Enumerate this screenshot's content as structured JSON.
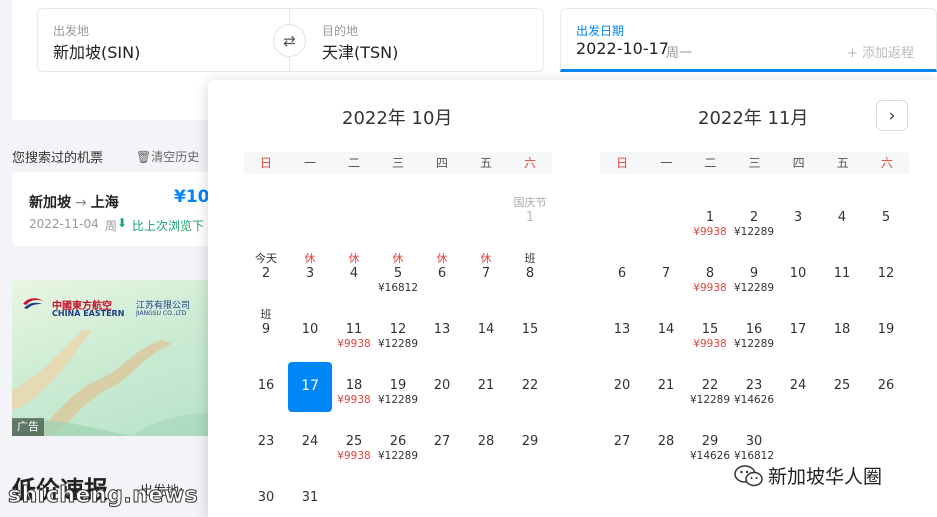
{
  "search": {
    "from_label": "出发地",
    "from_value": "新加坡(SIN)",
    "to_label": "目的地",
    "to_value": "天津(TSN)",
    "date_label": "出发日期",
    "date_value": "2022-10-17",
    "date_weekday": "周一",
    "add_return": "+ 添加返程"
  },
  "history": {
    "title": "您搜索过的机票",
    "clear": "清空历史",
    "card": {
      "from": "新加坡",
      "to": "上海",
      "price": "¥10",
      "date": "2022-11-04",
      "weekday": "周",
      "trend": "比上次浏览下"
    }
  },
  "ad": {
    "brand_cn": "中國東方航空",
    "brand_en": "CHINA EASTERN",
    "branch_cn": "江苏有限公司",
    "branch_en": "JIANGSU CO.,LTD",
    "tag": "广告"
  },
  "deals": {
    "title": "低价速报",
    "from_label": "出发地:"
  },
  "calendar": {
    "weekdays": [
      "日",
      "一",
      "二",
      "三",
      "四",
      "五",
      "六"
    ],
    "october": {
      "title": "2022年 10月",
      "days": [
        {
          "d": "1",
          "top": "国庆节",
          "top_type": "holiday",
          "muted": true
        },
        {
          "d": "2",
          "top": "今天"
        },
        {
          "d": "3",
          "top": "休",
          "top_type": "rest"
        },
        {
          "d": "4",
          "top": "休",
          "top_type": "rest"
        },
        {
          "d": "5",
          "top": "休",
          "top_type": "rest",
          "price": "¥16812"
        },
        {
          "d": "6",
          "top": "休",
          "top_type": "rest"
        },
        {
          "d": "7",
          "top": "休",
          "top_type": "rest"
        },
        {
          "d": "8",
          "top": "班"
        },
        {
          "d": "9",
          "top": "班"
        },
        {
          "d": "10"
        },
        {
          "d": "11",
          "price": "¥9938",
          "low": true
        },
        {
          "d": "12",
          "price": "¥12289"
        },
        {
          "d": "13"
        },
        {
          "d": "14"
        },
        {
          "d": "15"
        },
        {
          "d": "16"
        },
        {
          "d": "17",
          "selected": true
        },
        {
          "d": "18",
          "price": "¥9938",
          "low": true
        },
        {
          "d": "19",
          "price": "¥12289"
        },
        {
          "d": "20"
        },
        {
          "d": "21"
        },
        {
          "d": "22"
        },
        {
          "d": "23"
        },
        {
          "d": "24"
        },
        {
          "d": "25",
          "price": "¥9938",
          "low": true
        },
        {
          "d": "26",
          "price": "¥12289"
        },
        {
          "d": "27"
        },
        {
          "d": "28"
        },
        {
          "d": "29"
        },
        {
          "d": "30"
        },
        {
          "d": "31"
        }
      ]
    },
    "november": {
      "title": "2022年 11月",
      "days": [
        {
          "d": "1",
          "price": "¥9938",
          "low": true
        },
        {
          "d": "2",
          "price": "¥12289"
        },
        {
          "d": "3"
        },
        {
          "d": "4"
        },
        {
          "d": "5"
        },
        {
          "d": "6"
        },
        {
          "d": "7"
        },
        {
          "d": "8",
          "price": "¥9938",
          "low": true
        },
        {
          "d": "9",
          "price": "¥12289"
        },
        {
          "d": "10"
        },
        {
          "d": "11"
        },
        {
          "d": "12"
        },
        {
          "d": "13"
        },
        {
          "d": "14"
        },
        {
          "d": "15",
          "price": "¥9938",
          "low": true
        },
        {
          "d": "16",
          "price": "¥12289"
        },
        {
          "d": "17"
        },
        {
          "d": "18"
        },
        {
          "d": "19"
        },
        {
          "d": "20"
        },
        {
          "d": "21"
        },
        {
          "d": "22",
          "price": "¥12289"
        },
        {
          "d": "23",
          "price": "¥14626"
        },
        {
          "d": "24"
        },
        {
          "d": "25"
        },
        {
          "d": "26"
        },
        {
          "d": "27"
        },
        {
          "d": "28"
        },
        {
          "d": "29",
          "price": "¥14626"
        },
        {
          "d": "30",
          "price": "¥16812"
        }
      ]
    }
  },
  "watermarks": {
    "wechat": "新加坡华人圈",
    "site": "shicheng.news"
  },
  "colors": {
    "accent": "#0086f6",
    "rest": "#e0443c",
    "trend": "#1aa36b"
  }
}
